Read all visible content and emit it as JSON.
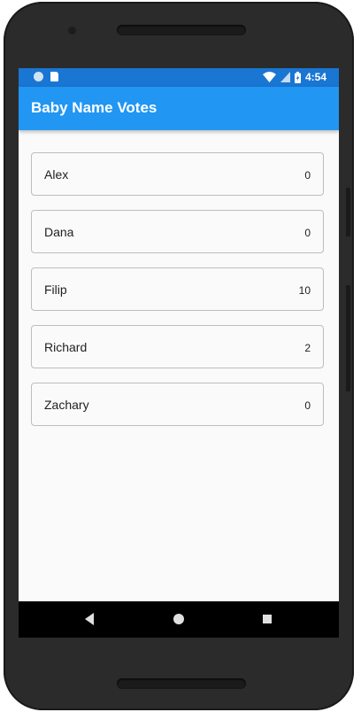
{
  "status_bar": {
    "time": "4:54",
    "icons": [
      "circle-notification-icon",
      "sd-card-icon",
      "wifi-icon",
      "signal-icon",
      "battery-icon"
    ]
  },
  "app_bar": {
    "title": "Baby Name Votes",
    "color": "#2196f3"
  },
  "names": [
    {
      "name": "Alex",
      "votes": "0"
    },
    {
      "name": "Dana",
      "votes": "0"
    },
    {
      "name": "Filip",
      "votes": "10"
    },
    {
      "name": "Richard",
      "votes": "2"
    },
    {
      "name": "Zachary",
      "votes": "0"
    }
  ],
  "nav_bar": {
    "icons": [
      "back-icon",
      "home-icon",
      "recent-apps-icon"
    ]
  }
}
